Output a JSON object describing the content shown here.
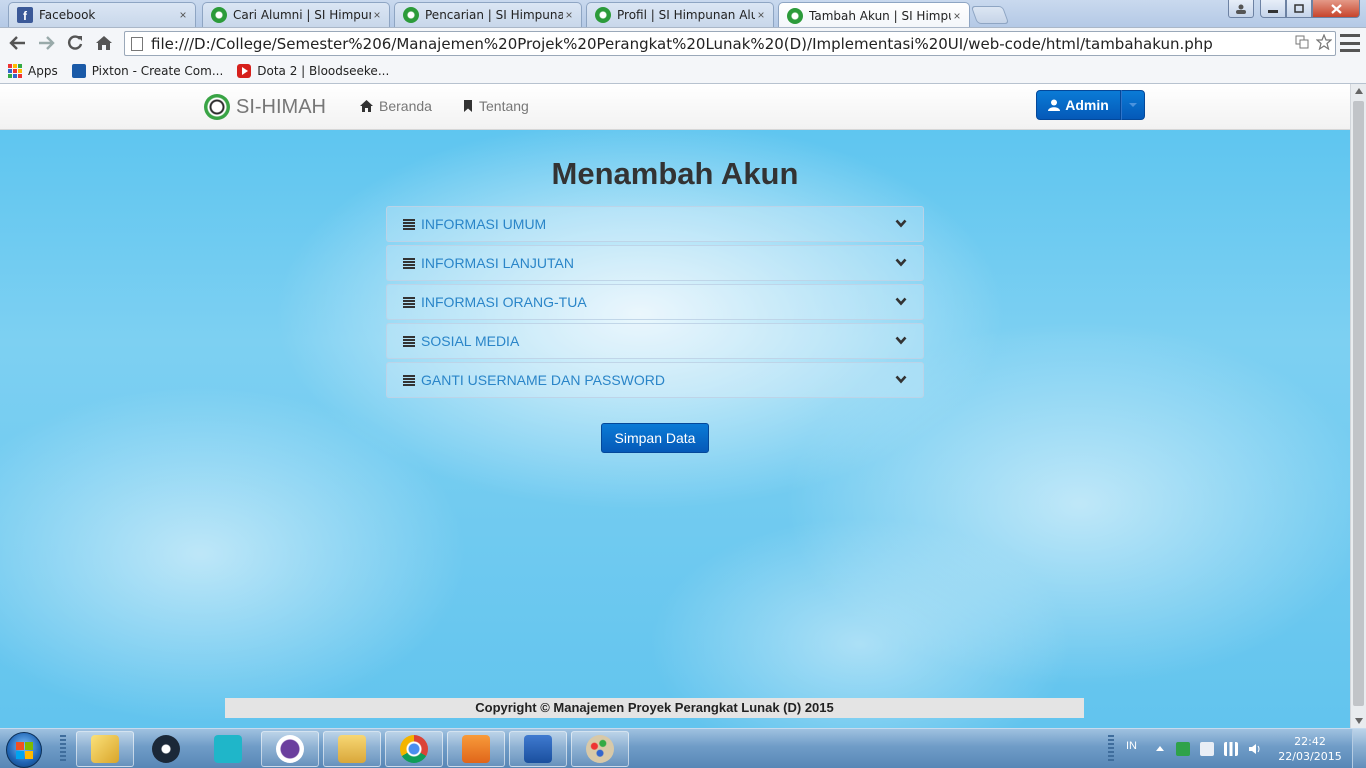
{
  "browser": {
    "tabs": [
      {
        "title": "Facebook",
        "icon": "facebook-icon"
      },
      {
        "title": "Cari Alumni | SI Himpunan Alumni",
        "icon": "sihimah-favicon"
      },
      {
        "title": "Pencarian | SI Himpunan Alumni",
        "icon": "sihimah-favicon"
      },
      {
        "title": "Profil | SI Himpunan Alumni",
        "icon": "sihimah-favicon"
      },
      {
        "title": "Tambah Akun | SI Himpunan",
        "icon": "sihimah-favicon"
      }
    ],
    "active_tab": 4,
    "close_glyph": "×",
    "url": "file:///D:/College/Semester%206/Manajemen%20Projek%20Perangkat%20Lunak%20(D)/Implementasi%20UI/web-code/html/tambahakun.php",
    "bookmarks": [
      {
        "label": "Apps",
        "icon": "apps-grid-icon"
      },
      {
        "label": "Pixton - Create Com...",
        "icon": "pixton-icon"
      },
      {
        "label": "Dota 2 | Bloodseeke...",
        "icon": "youtube-icon"
      }
    ]
  },
  "navbar": {
    "brand": "SI-HIMAH",
    "links": [
      {
        "label": "Beranda",
        "icon": "home-icon"
      },
      {
        "label": "Tentang",
        "icon": "bookmark-icon"
      }
    ],
    "user_button": "Admin"
  },
  "main": {
    "title": "Menambah Akun",
    "sections": [
      {
        "label": "INFORMASI UMUM"
      },
      {
        "label": "INFORMASI LANJUTAN"
      },
      {
        "label": "INFORMASI ORANG-TUA"
      },
      {
        "label": "SOSIAL MEDIA"
      },
      {
        "label": "GANTI USERNAME DAN PASSWORD"
      }
    ],
    "save_button": "Simpan Data"
  },
  "footer": {
    "copyright": "Copyright © Manajemen Proyek Perangkat Lunak (D) 2015"
  },
  "taskbar": {
    "apps": [
      "explorer-icon",
      "steam-icon",
      "star-app-icon",
      "cat-app-icon",
      "folder-icon",
      "chrome-icon",
      "foxit-pdf-icon",
      "word-icon",
      "paint-icon"
    ],
    "tray_language": "IN",
    "time": "22:42",
    "date": "22/03/2015"
  },
  "colors": {
    "accent_blue": "#0559b8",
    "link_blue": "#2a85c8",
    "brand_green": "#39a445"
  }
}
